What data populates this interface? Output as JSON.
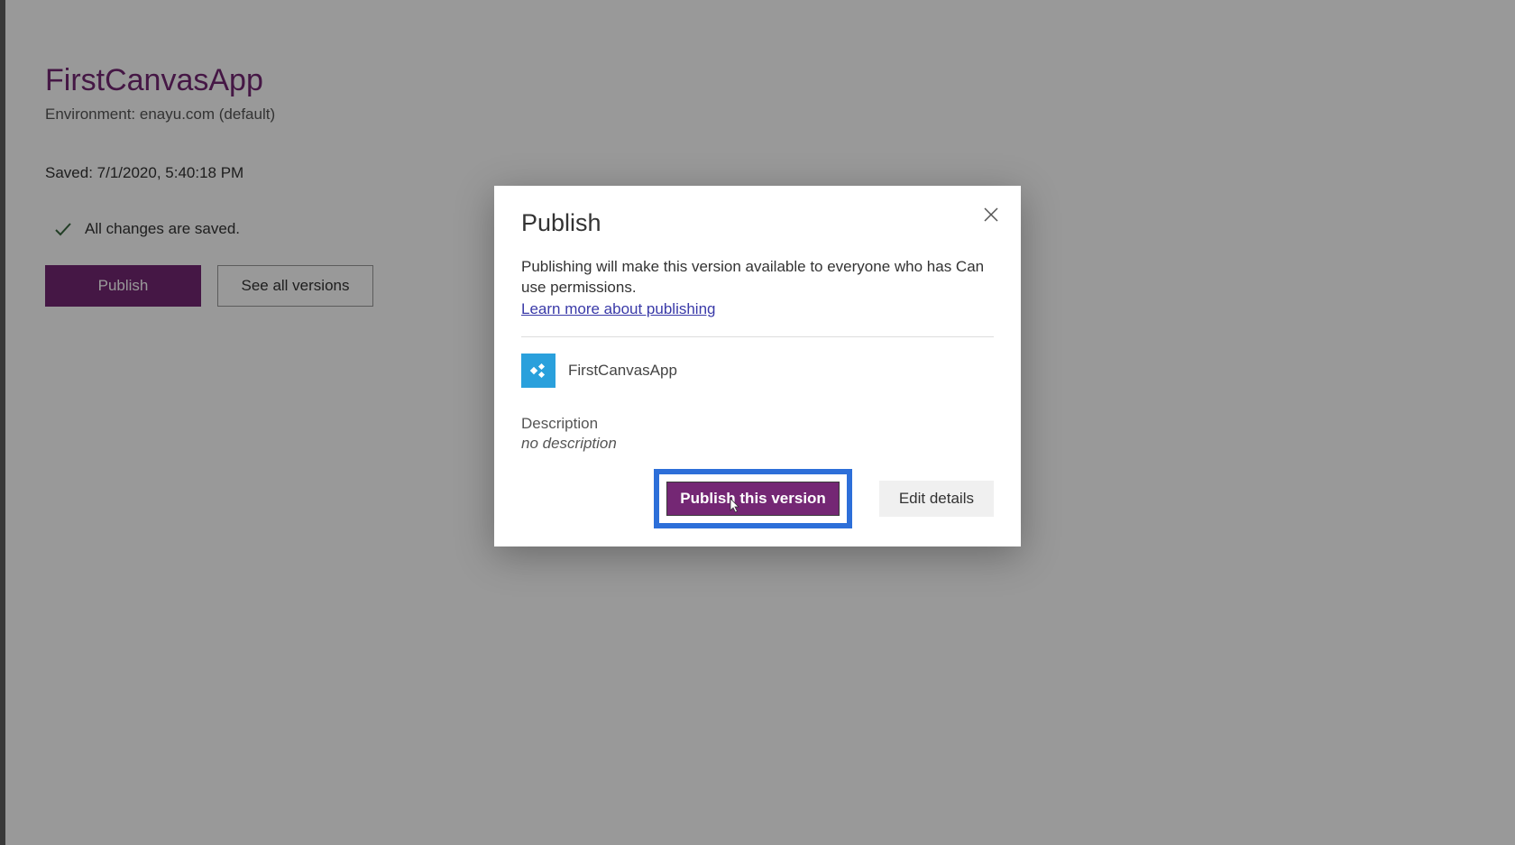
{
  "page": {
    "app_title": "FirstCanvasApp",
    "environment_label": "Environment: enayu.com (default)",
    "saved_label": "Saved: 7/1/2020, 5:40:18 PM",
    "changes_saved": "All changes are saved.",
    "publish_button": "Publish",
    "see_versions_button": "See all versions"
  },
  "dialog": {
    "title": "Publish",
    "description": "Publishing will make this version available to everyone who has Can use permissions.",
    "learn_more": "Learn more about publishing",
    "app_name": "FirstCanvasApp",
    "description_label": "Description",
    "description_value": "no description",
    "publish_button": "Publish this version",
    "edit_button": "Edit details"
  },
  "colors": {
    "brand_purple": "#742774",
    "highlight_blue": "#2d6fd9",
    "app_icon_blue": "#2aa0dc"
  }
}
